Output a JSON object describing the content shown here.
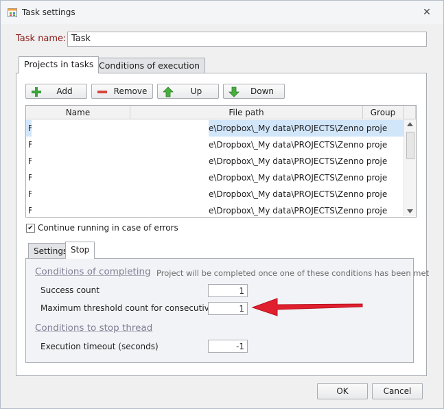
{
  "window": {
    "title": "Task settings"
  },
  "task_name": {
    "label": "Task name:",
    "value": "Task"
  },
  "tabs": [
    {
      "label": "Projects in tasks",
      "active": true
    },
    {
      "label": "Conditions of execution",
      "active": false
    }
  ],
  "toolbar": {
    "add": "Add",
    "remove": "Remove",
    "up": "Up",
    "down": "Down"
  },
  "table": {
    "columns": [
      "Name",
      "File path",
      "Group"
    ],
    "rows": [
      {
        "name": "F",
        "path": "e\\Dropbox\\_My data\\PROJECTS\\Zenno projects\\F...",
        "group": "",
        "selected": true
      },
      {
        "name": "F",
        "path": "e\\Dropbox\\_My data\\PROJECTS\\Zenno projects\\F...",
        "group": "",
        "selected": false
      },
      {
        "name": "F",
        "path": "e\\Dropbox\\_My data\\PROJECTS\\Zenno projects\\F...",
        "group": "",
        "selected": false
      },
      {
        "name": "F",
        "path": "e\\Dropbox\\_My data\\PROJECTS\\Zenno projects\\F...",
        "group": "",
        "selected": false
      },
      {
        "name": "F",
        "path": "e\\Dropbox\\_My data\\PROJECTS\\Zenno projects\\F...",
        "group": "",
        "selected": false
      },
      {
        "name": "F",
        "path": "e\\Dropbox\\_My data\\PROJECTS\\Zenno projects\\F...",
        "group": "",
        "selected": false
      }
    ]
  },
  "continue_on_errors": {
    "label": "Continue running in case of errors",
    "checked": true
  },
  "sub_tabs": [
    {
      "label": "Settings",
      "active": false
    },
    {
      "label": "Stop",
      "active": true
    }
  ],
  "completing": {
    "title": "Conditions of completing",
    "hint": "Project will be completed once one of these conditions has been met",
    "success_label": "Success count",
    "success_value": "1",
    "failures_label": "Maximum threshold count for consecutive failures",
    "failures_value": "1"
  },
  "stop_thread": {
    "title": "Conditions to stop thread",
    "timeout_label": "Execution timeout (seconds)",
    "timeout_value": "-1"
  },
  "dialog_buttons": {
    "ok": "OK",
    "cancel": "Cancel"
  },
  "colors": {
    "annotation_arrow": "#e0202e",
    "selection": "#d2e6fa",
    "label_red": "#8b1a1a"
  },
  "icons": [
    "task-settings-icon",
    "close-icon",
    "add-icon",
    "remove-icon",
    "up-arrow-icon",
    "down-arrow-icon",
    "checkbox-check-icon",
    "annotation-arrow"
  ]
}
